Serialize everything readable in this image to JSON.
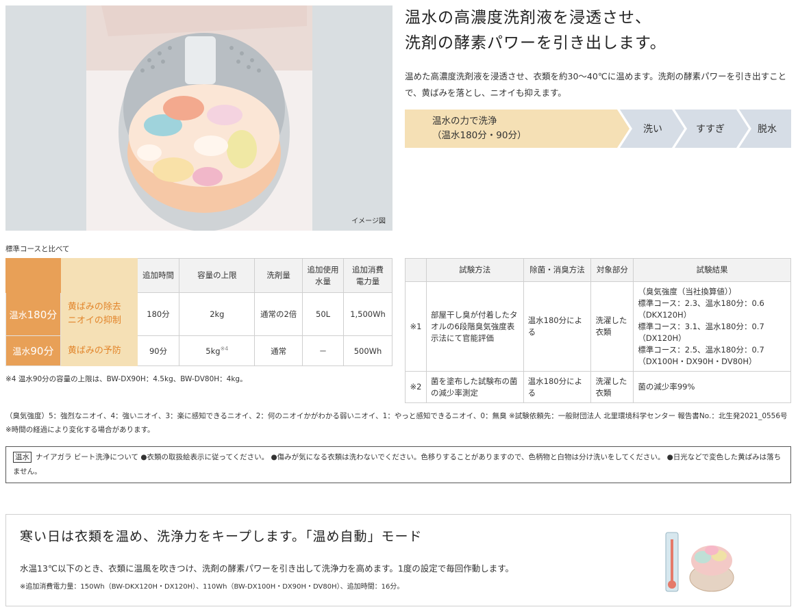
{
  "hero": {
    "caption": "イメージ図",
    "alt_icon": "washing-drum-illustration"
  },
  "headline": {
    "line1": "温水の高濃度洗剤液を浸透させ、",
    "line2": "洗剤の酵素パワーを引き出します。"
  },
  "lead": {
    "text": "温めた高濃度洗剤液を浸透させ、衣類を約30～40℃に温めます。洗剤の酵素パワーを引き出すことで、黄ばみを落とし、ニオイも抑えます。"
  },
  "flow": {
    "step1_line1": "温水の力で洗浄",
    "step1_line2": "（温水180分・90分）",
    "step2": "洗い",
    "step3": "すすぎ",
    "step4": "脱水",
    "colors": {
      "step1": "#f5e0b5",
      "rest": "#d6dde6"
    }
  },
  "comparison": {
    "caption": "標準コースと比べて",
    "headers": [
      "追加時間",
      "容量の上限",
      "洗剤量",
      "追加使用水量",
      "追加消費電力量"
    ],
    "rows": [
      {
        "name_prefix": "温水",
        "name_value": "180分",
        "feature_line1": "黄ばみの除去",
        "feature_line2": "ニオイの抑制",
        "cells": [
          "180分",
          "2kg",
          "通常の2倍",
          "50L",
          "1,500Wh"
        ]
      },
      {
        "name_prefix": "温水",
        "name_value": "90分",
        "feature_line1": "黄ばみの予防",
        "cells": [
          "90分",
          "5kg",
          "通常",
          "－",
          "500Wh"
        ],
        "capacity_note": "※4"
      }
    ],
    "note": "※4 温水90分の容量の上限は、BW-DX90H：4.5kg、BW-DV80H：4kg。",
    "colors": {
      "name_bg": "#e8a057",
      "feature_bg": "#f5e0b5",
      "feature_text": "#e2852b"
    }
  },
  "tests": {
    "headers": [
      "試験方法",
      "除菌・消臭方法",
      "対象部分",
      "試験結果"
    ],
    "rows": [
      {
        "mark": "※1",
        "method": "部屋干し臭が付着したタオルの6段階臭気強度表示法にて官能評価",
        "treatment": "温水180分による",
        "target": "洗濯した衣類",
        "result": [
          "（臭気強度（当社換算値））",
          "標準コース：2.3、温水180分：0.6",
          "（DKX120H）",
          "標準コース：3.1、温水180分：0.7",
          "（DX120H）",
          "標準コース：2.5、温水180分：0.7",
          "（DX100H・DX90H・DV80H）"
        ]
      },
      {
        "mark": "※2",
        "method": "菌を塗布した試験布の菌の減少率測定",
        "treatment": "温水180分による",
        "target": "洗濯した衣類",
        "result": [
          "菌の減少率99%"
        ]
      }
    ]
  },
  "footnote": {
    "text": "（臭気強度）5：強烈なニオイ、4：強いニオイ、3：楽に感知できるニオイ、2：何のニオイかがわかる弱いニオイ、1：やっと感知できるニオイ、0：無臭 ※試験依頼先：一般財団法人 北里環境科学センター 報告書No.：北生発2021_0556号 ※時間の経過により変化する場合があります。"
  },
  "notice": {
    "tag": "温水",
    "text": "ナイアガラ ビート洗浄について ●衣類の取扱絵表示に従ってください。 ●傷みが気になる衣類は洗わないでください。色移りすることがありますので、色柄物と白物は分け洗いをしてください。 ●日光などで変色した黄ばみは落ちません。"
  },
  "mode": {
    "title": "寒い日は衣類を温め、洗浄力をキープします。「温め自動」モード",
    "text": "水温13℃以下のとき、衣類に温風を吹きつけ、洗剤の酵素パワーを引き出して洗浄力を高めます。1度の設定で毎回作動します。",
    "note": "※追加消費電力量：150Wh（BW-DKX120H・DX120H）、110Wh（BW-DX100H・DX90H・DV80H）、追加時間：16分。",
    "illust_icon": "thermometer-laundry-basket-illustration"
  }
}
